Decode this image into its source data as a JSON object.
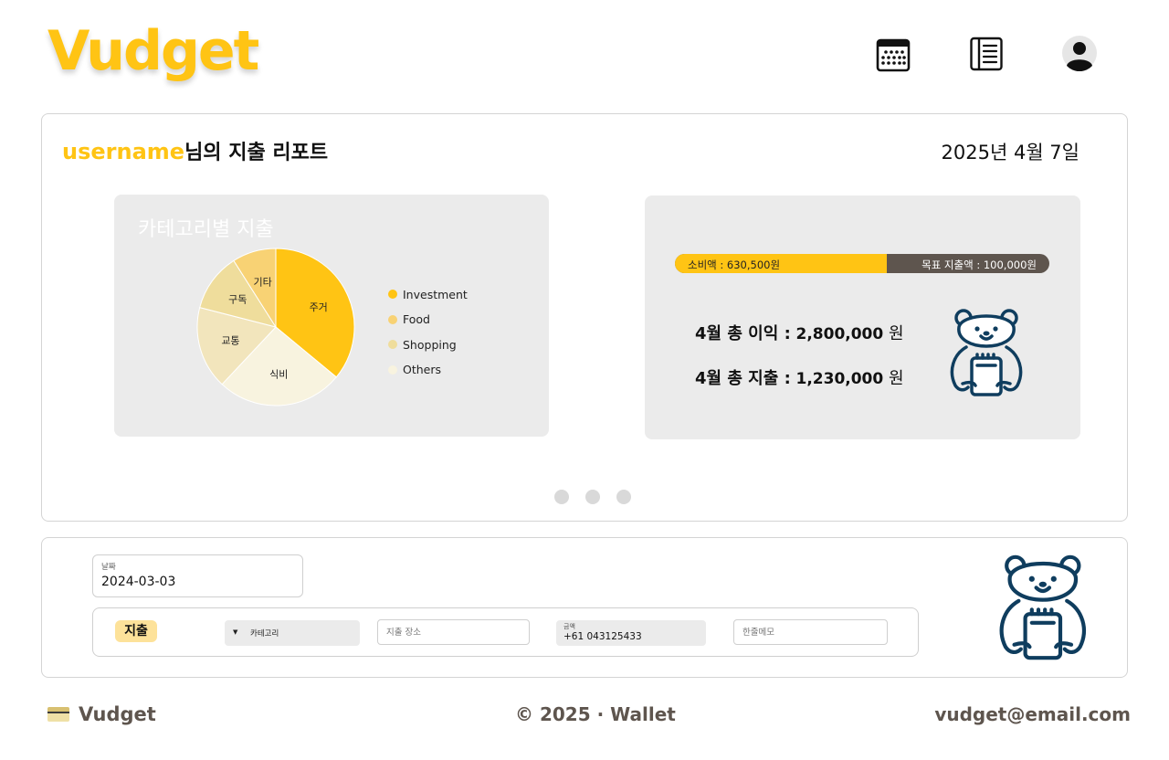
{
  "app": {
    "logo": "Vudget"
  },
  "header": {
    "icons": [
      "calendar-icon",
      "ledger-icon",
      "profile-icon"
    ]
  },
  "report": {
    "username": "username",
    "title_suffix": "님의 지출 리포트",
    "date": "2025년 4월 7일"
  },
  "chart_data": {
    "type": "pie",
    "title": "카테고리별 지출",
    "slices": [
      {
        "label": "주거",
        "value": 36,
        "color": "#FFC414"
      },
      {
        "label": "식비",
        "value": 26,
        "color": "#F8F3DF"
      },
      {
        "label": "교통",
        "value": 17,
        "color": "#F2E5BC"
      },
      {
        "label": "구독",
        "value": 12,
        "color": "#EFDD9C"
      },
      {
        "label": "기타",
        "value": 9,
        "color": "#F8D274"
      }
    ],
    "legend": [
      {
        "label": "Investment",
        "color": "#FFC414"
      },
      {
        "label": "Food",
        "color": "#F8D274"
      },
      {
        "label": "Shopping",
        "color": "#EFDD9C"
      },
      {
        "label": "Others",
        "color": "#F8F3DF"
      }
    ],
    "legend_position": "right"
  },
  "summary": {
    "spent_label": "소비액 : 630,500원",
    "goal_label": "목표 지출액 : 100,000원",
    "progress_fraction": 0.565,
    "income_label": "4월 총 이익 :",
    "income_amount": "2,800,000",
    "expense_label": "4월 총 지출 :",
    "expense_amount": "1,230,000",
    "currency_unit": "원"
  },
  "carousel": {
    "pages": 3
  },
  "entry": {
    "date_label": "날짜",
    "date_value": "2024-03-03",
    "type_badge": "지출",
    "category_placeholder": "카테고리",
    "place_placeholder": "지출 장소",
    "amount_label": "금액",
    "amount_value": "+61 043125433",
    "memo_placeholder": "한줄메모"
  },
  "footer": {
    "brand": "Vudget",
    "copyright": "© 2025 · Wallet",
    "email": "vudget@email.com"
  },
  "colors": {
    "brand_yellow": "#FFC414",
    "brown": "#5E554E",
    "panel_gray": "#EBEBEB",
    "bear_navy": "#0F3D5E"
  }
}
